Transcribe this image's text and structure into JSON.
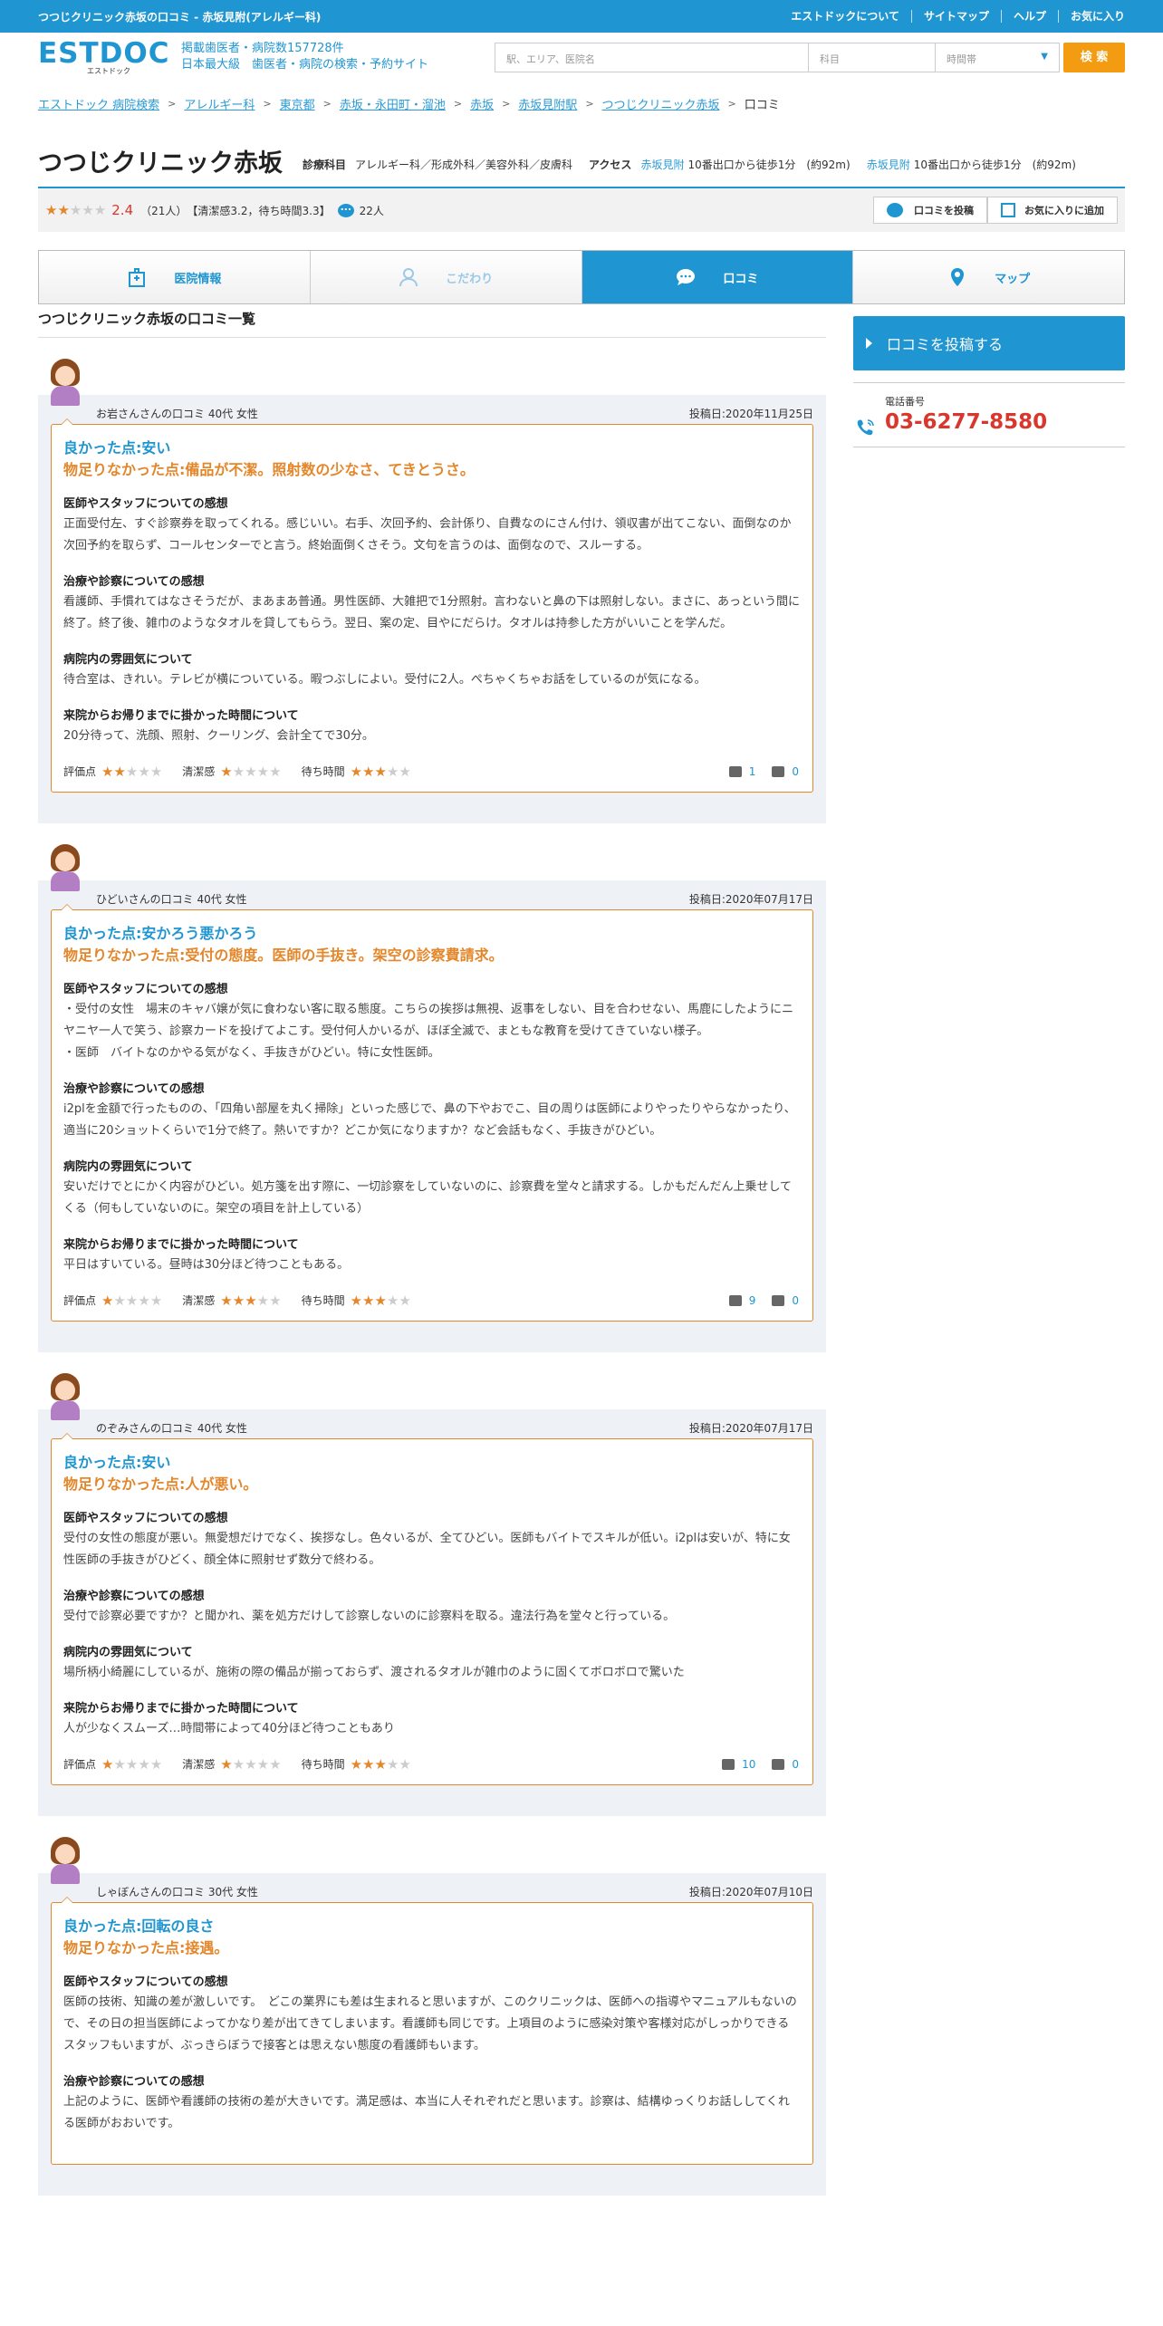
{
  "top": {
    "title": "つつじクリニック赤坂の口コミ - 赤坂見附(アレルギー科)",
    "links": [
      "エストドックについて",
      "サイトマップ",
      "ヘルプ",
      "お気に入り"
    ]
  },
  "header": {
    "logo": "ESTDOC",
    "logo_sub": "エストドック",
    "tagline1": "掲載歯医者・病院数157728件",
    "tagline2": "日本最大級　歯医者・病院の検索・予約サイト",
    "search_placeholder": "駅、エリア、医院名",
    "subject_placeholder": "科目",
    "time_placeholder": "時間帯",
    "search_button": "検 索"
  },
  "breadcrumb": [
    "エストドック 病院検索",
    "アレルギー科",
    "東京都",
    "赤坂・永田町・溜池",
    "赤坂",
    "赤坂見附駅",
    "つつじクリニック赤坂"
  ],
  "breadcrumb_current": "口コミ",
  "clinic": {
    "name": "つつじクリニック赤坂",
    "dept_label": "診療科目",
    "depts": "アレルギー科／形成外科／美容外科／皮膚科",
    "access_label": "アクセス",
    "station1": "赤坂見附",
    "route1": "10番出口から徒歩1分　(約92m)",
    "station2": "赤坂見附",
    "route2": "10番出口から徒歩1分　(約92m)",
    "rating": 2.4,
    "rating_text": "2.4",
    "review_count": "（21人）",
    "sub_scores": "【清潔感3.2，待ち時間3.3】",
    "comments": "22人",
    "post_btn": "口コミを投稿",
    "fav_btn": "お気に入りに追加"
  },
  "tabs": [
    {
      "label": "医院情報",
      "icon": "hospital-icon"
    },
    {
      "label": "こだわり",
      "icon": "doctor-icon"
    },
    {
      "label": "口コミ",
      "icon": "chat-icon"
    },
    {
      "label": "マップ",
      "icon": "map-pin-icon"
    }
  ],
  "section_title": "つつじクリニック赤坂の口コミ一覧",
  "labels": {
    "q1": "医師やスタッフについての感想",
    "q2": "治療や診察についての感想",
    "q3": "病院内の雰囲気について",
    "q4": "来院からお帰りまでに掛かった時間について",
    "s1": "評価点",
    "s2": "清潔感",
    "s3": "待ち時間"
  },
  "reviews": [
    {
      "author": "お岩さんさんの口コミ 40代  女性",
      "date": "投稿日:2020年11月25日",
      "good": "良かった点:安い",
      "bad": "物足りなかった点:備品が不潔。照射数の少なさ、てきとうさ。",
      "a1": "正面受付左、すぐ診察券を取ってくれる。感じいい。右手、次回予約、会計係り、自費なのにさん付け、領収書が出てこない、面倒なのか次回予約を取らず、コールセンターでと言う。終始面倒くさそう。文句を言うのは、面倒なので、スルーする。",
      "a2": "看護師、手慣れてはなさそうだが、まあまあ普通。男性医師、大雑把で1分照射。言わないと鼻の下は照射しない。まさに、あっという間に終了。終了後、雑巾のようなタオルを貸してもらう。翌日、案の定、目やにだらけ。タオルは持参した方がいいことを学んだ。",
      "a3": "待合室は、きれい。テレビが横についている。暇つぶしによい。受付に2人。ぺちゃくちゃお話をしているのが気になる。",
      "a4": "20分待って、洗顔、照射、クーリング、会計全てで30分。",
      "score": 2,
      "clean": 1,
      "wait": 3,
      "up": "1",
      "down": "0"
    },
    {
      "author": "ひどいさんの口コミ 40代  女性",
      "date": "投稿日:2020年07月17日",
      "good": "良かった点:安かろう悪かろう",
      "bad": "物足りなかった点:受付の態度。医師の手抜き。架空の診察費請求。",
      "a1": "・受付の女性　場末のキャバ嬢が気に食わない客に取る態度。こちらの挨拶は無視、返事をしない、目を合わせない、馬鹿にしたようにニヤニヤ一人で笑う、診察カードを投げてよこす。受付何人かいるが、ほぼ全滅で、まともな教育を受けてきていない様子。\n・医師　バイトなのかやる気がなく、手抜きがひどい。特に女性医師。",
      "a2": "i2plを金額で行ったものの、「四角い部屋を丸く掃除」といった感じで、鼻の下やおでこ、目の周りは医師によりやったりやらなかったり、適当に20ショットくらいで1分で終了。熱いですか？どこか気になりますか？など会話もなく、手抜きがひどい。",
      "a3": "安いだけでとにかく内容がひどい。処方箋を出す際に、一切診察をしていないのに、診察費を堂々と請求する。しかもだんだん上乗せしてくる（何もしていないのに。架空の項目を計上している）",
      "a4": "平日はすいている。昼時は30分ほど待つこともある。",
      "score": 1,
      "clean": 3,
      "wait": 3,
      "up": "9",
      "down": "0"
    },
    {
      "author": "のぞみさんの口コミ 40代  女性",
      "date": "投稿日:2020年07月17日",
      "good": "良かった点:安い",
      "bad": "物足りなかった点:人が悪い。",
      "a1": "受付の女性の態度が悪い。無愛想だけでなく、挨拶なし。色々いるが、全てひどい。医師もバイトでスキルが低い。i2plは安いが、特に女性医師の手抜きがひどく、顔全体に照射せず数分で終わる。",
      "a2": "受付で診察必要ですか？と聞かれ、薬を処方だけして診察しないのに診察料を取る。違法行為を堂々と行っている。",
      "a3": "場所柄小綺麗にしているが、施術の際の備品が揃っておらず、渡されるタオルが雑巾のように固くてボロボロで驚いた",
      "a4": "人が少なくスムーズ…時間帯によって40分ほど待つこともあり",
      "score": 1,
      "clean": 1,
      "wait": 3,
      "up": "10",
      "down": "0"
    },
    {
      "author": "しゃぼんさんの口コミ 30代  女性",
      "date": "投稿日:2020年07月10日",
      "good": "良かった点:回転の良さ",
      "bad": "物足りなかった点:接遇。",
      "a1": "医師の技術、知識の差が激しいです。　どこの業界にも差は生まれると思いますが、このクリニックは、医師への指導やマニュアルもないので、その日の担当医師によってかなり差が出てきてしまいます。看護師も同じです。上項目のように感染対策や客様対応がしっかりできるスタッフもいますが、ぶっきらぼうで接客とは思えない態度の看護師もいます。",
      "a2": "上記のように、医師や看護師の技術の差が大きいです。満足感は、本当に人それぞれだと思います。診察は、結構ゆっくりお話ししてくれる医師がおおいです。"
    }
  ],
  "sidebar": {
    "post": "口コミを投稿する",
    "phone_label": "電話番号",
    "phone": "03-6277-8580"
  }
}
